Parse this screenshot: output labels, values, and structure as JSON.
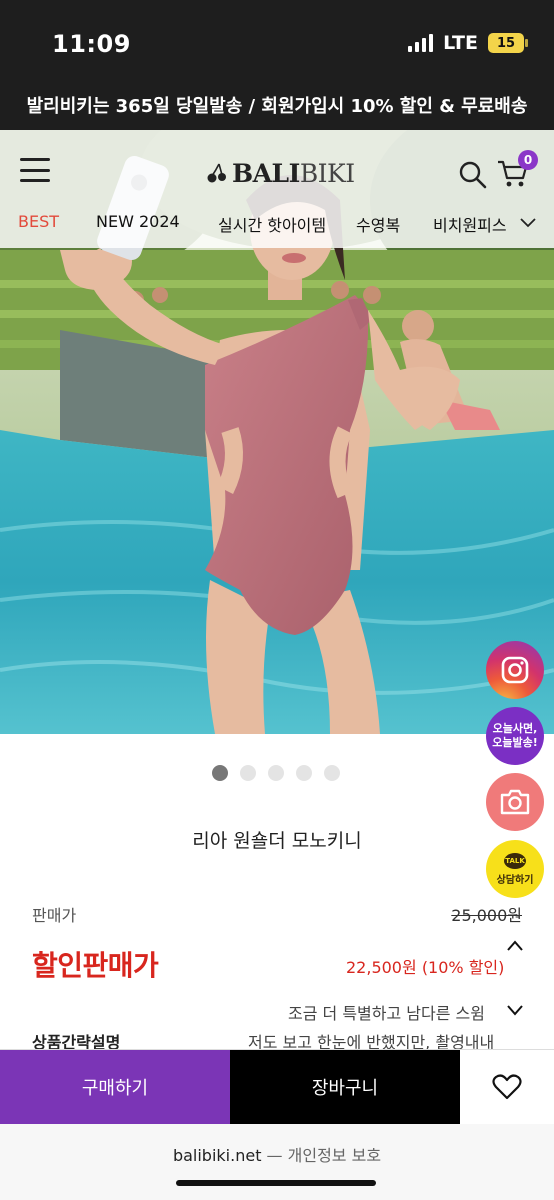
{
  "status_bar": {
    "time": "11:09",
    "network": "LTE",
    "battery": "15"
  },
  "promo_banner": {
    "text": "발리비키는 365일 당일발송 / 회원가입시 10% 할인 & 무료배송"
  },
  "header": {
    "logo_bold": "BALI",
    "logo_light": "BIKI",
    "cart_count": "0",
    "nav": [
      {
        "label": "BEST",
        "active": true
      },
      {
        "label": "NEW 2024",
        "active": false
      },
      {
        "label": "실시간 핫아이템",
        "active": false
      },
      {
        "label": "수영복",
        "active": false
      },
      {
        "label": "비치원피스",
        "active": false
      }
    ]
  },
  "carousel": {
    "total": 5,
    "active_index": 0
  },
  "floating": {
    "today_line1": "오늘사면,",
    "today_line2": "오늘발송!",
    "talk_badge": "TALK",
    "talk_label": "상담하기"
  },
  "product": {
    "name": "리아 원숄더 모노키니",
    "price_label": "판매가",
    "original_price": "25,000원",
    "sale_label": "할인판매가",
    "sale_price": "22,500원",
    "discount": "(10% 할인)",
    "desc_label": "상품간략설명",
    "desc_line1": "조금 더 특별하고 남다른 스윔",
    "desc_line2": "저도 보고 한눈에 반했지만, 촬영내내"
  },
  "actions": {
    "buy": "구매하기",
    "cart": "장바구니"
  },
  "browser": {
    "domain": "balibiki.net",
    "suffix": " — 개인정보 보호"
  },
  "colors": {
    "accent_purple": "#7b35b6",
    "sale_red": "#d8261e",
    "nav_active": "#e24a3b"
  }
}
